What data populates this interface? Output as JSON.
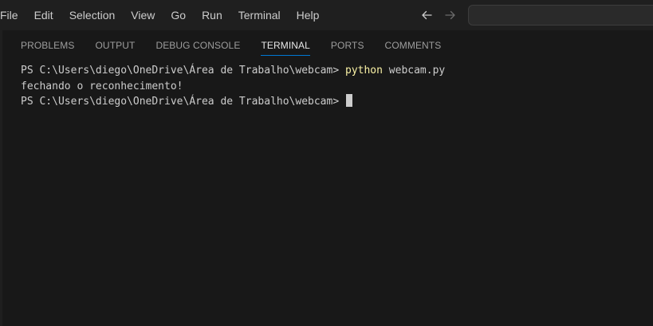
{
  "menubar": {
    "items": [
      "File",
      "Edit",
      "Selection",
      "View",
      "Go",
      "Run",
      "Terminal",
      "Help"
    ]
  },
  "navigation": {
    "back_icon": "arrow-left-icon",
    "forward_icon": "arrow-right-icon"
  },
  "search": {
    "placeholder": ""
  },
  "panel": {
    "tabs": [
      "PROBLEMS",
      "OUTPUT",
      "DEBUG CONSOLE",
      "TERMINAL",
      "PORTS",
      "COMMENTS"
    ],
    "active_tab": "TERMINAL"
  },
  "terminal": {
    "line1_prompt": "PS C:\\Users\\diego\\OneDrive\\Área de Trabalho\\webcam> ",
    "line1_cmd": "python",
    "line1_args": " webcam.py",
    "line2": "fechando o reconhecimento!",
    "line3_prompt": "PS C:\\Users\\diego\\OneDrive\\Área de Trabalho\\webcam> "
  },
  "colors": {
    "background": "#181818",
    "menubar": "#1f1f1f",
    "accent": "#0078d4",
    "command_highlight": "#f9f1a5",
    "text": "#cccccc"
  }
}
